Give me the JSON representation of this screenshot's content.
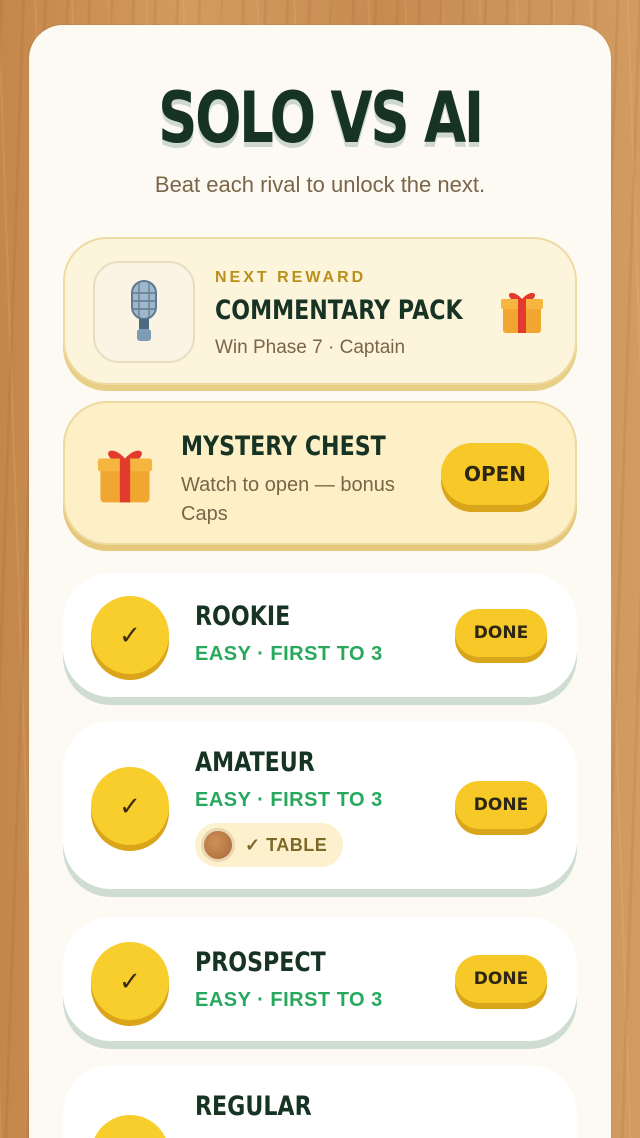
{
  "header": {
    "title": "SOLO VS AI",
    "subtitle": "Beat each rival to unlock the next."
  },
  "next_reward": {
    "kicker": "NEXT REWARD",
    "name": "COMMENTARY PACK",
    "requirement": "Win Phase 7 · Captain",
    "icon": "microphone-icon",
    "badge_icon": "gift-icon"
  },
  "mystery_chest": {
    "name": "MYSTERY CHEST",
    "description": "Watch to open — bonus Caps",
    "button_label": "OPEN",
    "icon": "gift-icon"
  },
  "levels": [
    {
      "name": "ROOKIE",
      "meta": "EASY · FIRST TO 3",
      "button_label": "DONE",
      "status_icon": "check-icon"
    },
    {
      "name": "AMATEUR",
      "meta": "EASY · FIRST TO 3",
      "button_label": "DONE",
      "status_icon": "check-icon",
      "unlock": "✓ TABLE"
    },
    {
      "name": "PROSPECT",
      "meta": "EASY · FIRST TO 3",
      "button_label": "DONE",
      "status_icon": "check-icon"
    },
    {
      "name": "REGULAR"
    }
  ],
  "colors": {
    "accent": "#f7c928",
    "title": "#163324",
    "meta_green": "#27a85d"
  }
}
